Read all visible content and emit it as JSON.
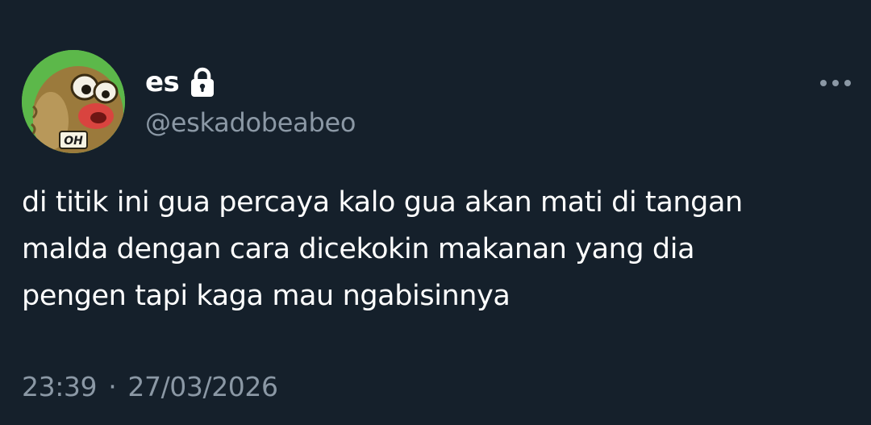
{
  "author": {
    "display_name": "es",
    "handle": "@eskadobeabeo",
    "protected": true,
    "avatar_caption": "OH"
  },
  "tweet": {
    "lines": [
      "di titik ini gua percaya kalo gua akan mati di tangan",
      "malda dengan cara dicekokin makanan yang dia",
      "pengen tapi kaga mau ngabisinnya"
    ],
    "time": "23:39",
    "separator": "·",
    "date": "27/03/2026"
  },
  "icons": {
    "protected": "lock-icon",
    "menu": "more-options-icon"
  },
  "colors": {
    "background": "#15202b",
    "primary_text": "#ffffff",
    "secondary_text": "#8b98a5",
    "avatar_bg": "#5cb84a"
  }
}
